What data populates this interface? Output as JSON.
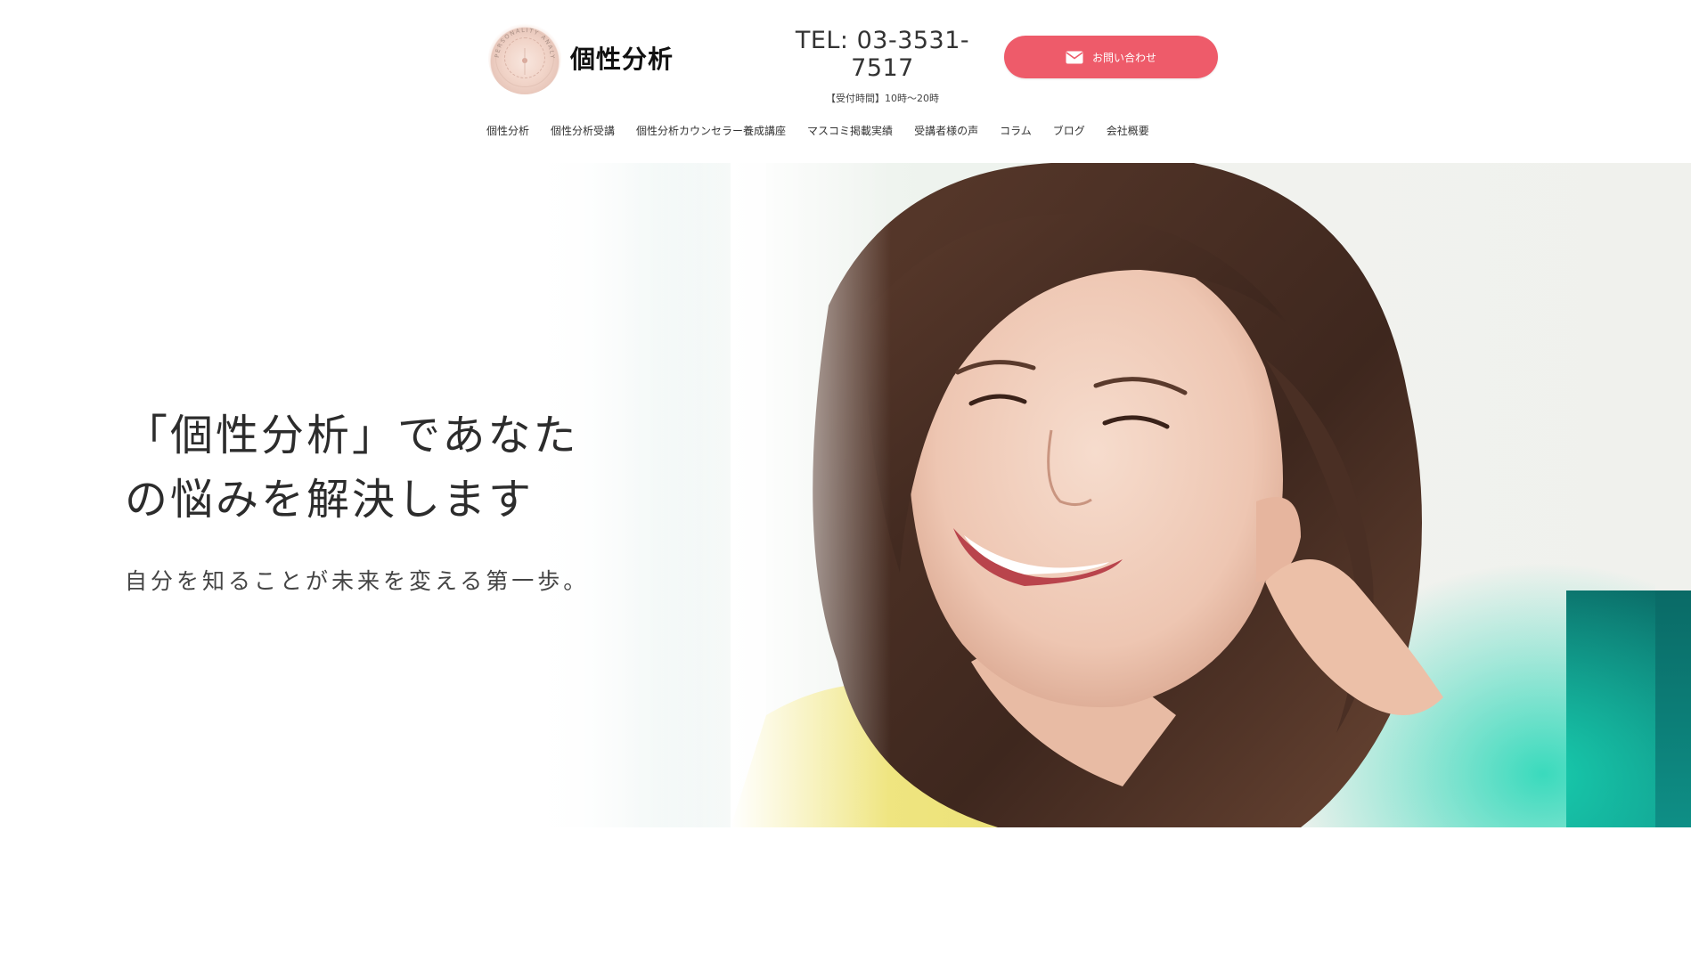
{
  "brand": {
    "name": "個性分析",
    "emblem_text": "PERSONALITY ANALYSIS"
  },
  "contact": {
    "tel": "TEL: 03-3531-7517",
    "hours": "【受付時間】10時〜20時",
    "button_label": "お問い合わせ"
  },
  "nav": {
    "items": [
      {
        "label": "個性分析"
      },
      {
        "label": "個性分析受講"
      },
      {
        "label": "個性分析カウンセラー養成講座"
      },
      {
        "label": "マスコミ掲載実績"
      },
      {
        "label": "受講者様の声"
      },
      {
        "label": "コラム"
      },
      {
        "label": "ブログ"
      },
      {
        "label": "会社概要"
      }
    ]
  },
  "hero": {
    "title_line1": "「個性分析」であなた",
    "title_line2": "の悩みを解決します",
    "subtitle": "自分を知ることが未来を変える第一歩。"
  },
  "colors": {
    "accent": "#ee5b6a",
    "text": "#333333",
    "teal": "#1ad6b4"
  }
}
